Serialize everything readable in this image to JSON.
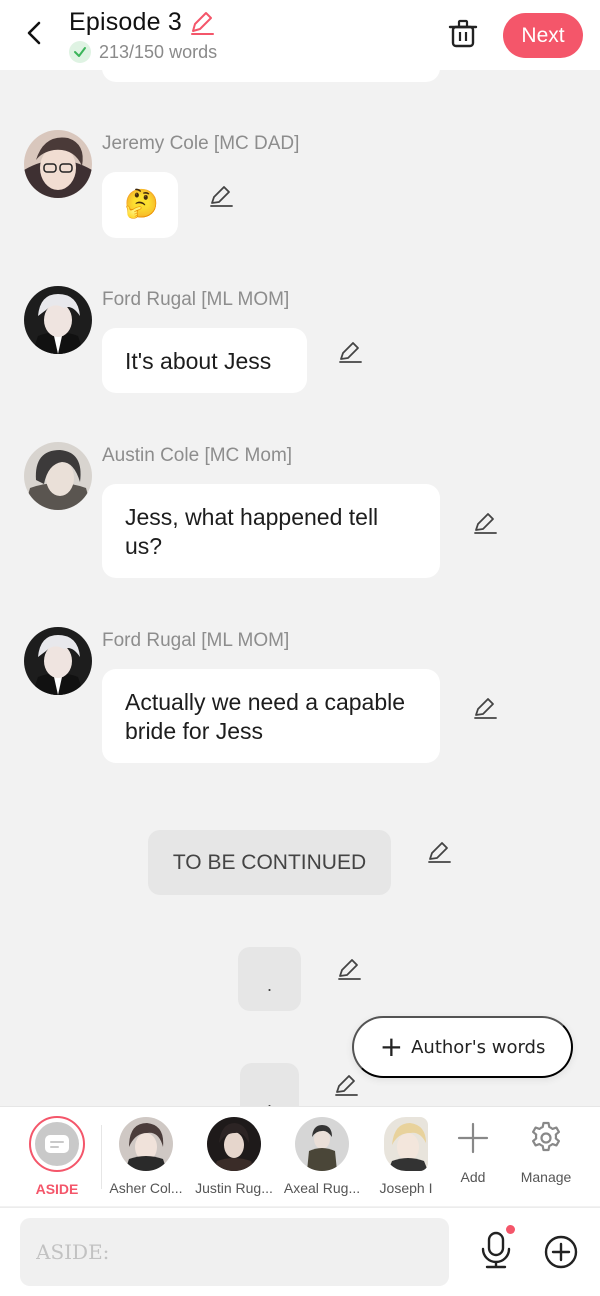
{
  "header": {
    "title": "Episode 3",
    "word_count": "213/150 words",
    "next_label": "Next"
  },
  "messages": [
    {
      "name": "Jeremy Cole [MC DAD]",
      "text": "🤔"
    },
    {
      "name": "Ford Rugal [ML MOM]",
      "text": "It's about Jess"
    },
    {
      "name": "Austin Cole [MC Mom]",
      "text": "Jess, what happened tell us?"
    },
    {
      "name": "Ford Rugal [ML MOM]",
      "text": "Actually we need a capable bride for Jess"
    }
  ],
  "asides": [
    {
      "text": "TO BE CONTINUED"
    },
    {
      "text": "."
    },
    {
      "text": "."
    }
  ],
  "authors_words_label": "Author's words",
  "characters": [
    {
      "label": "ASIDE"
    },
    {
      "label": "Asher Col..."
    },
    {
      "label": "Justin Rug..."
    },
    {
      "label": "Axeal Rug..."
    },
    {
      "label": "Joseph I"
    },
    {
      "label": "Add"
    },
    {
      "label": "Manage"
    }
  ],
  "input": {
    "placeholder": "ASIDE:"
  },
  "colors": {
    "accent": "#f4566a",
    "background": "#f2f2f2",
    "bubble": "#ffffff",
    "aside_box": "#e6e6e6"
  },
  "icons": [
    "back-arrow-icon",
    "pencil-icon",
    "check-icon",
    "trash-icon",
    "plus-icon",
    "gear-icon",
    "microphone-icon",
    "plus-circle-icon",
    "aside-icon"
  ]
}
